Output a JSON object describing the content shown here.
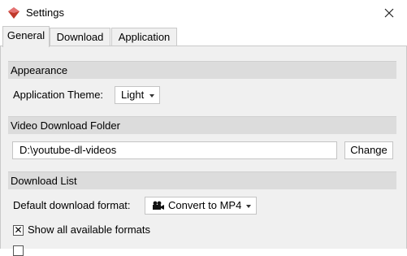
{
  "window": {
    "title": "Settings"
  },
  "tabs": [
    "General",
    "Download",
    "Application"
  ],
  "active_tab": "General",
  "appearance": {
    "header": "Appearance",
    "theme_label": "Application Theme:",
    "theme_value": "Light"
  },
  "download_folder": {
    "header": "Video Download Folder",
    "path": "D:\\youtube-dl-videos",
    "change_label": "Change"
  },
  "download_list": {
    "header": "Download List",
    "format_label": "Default download format:",
    "format_value": "Convert to MP4",
    "show_formats_label": "Show all available formats",
    "show_formats_checked": true
  }
}
